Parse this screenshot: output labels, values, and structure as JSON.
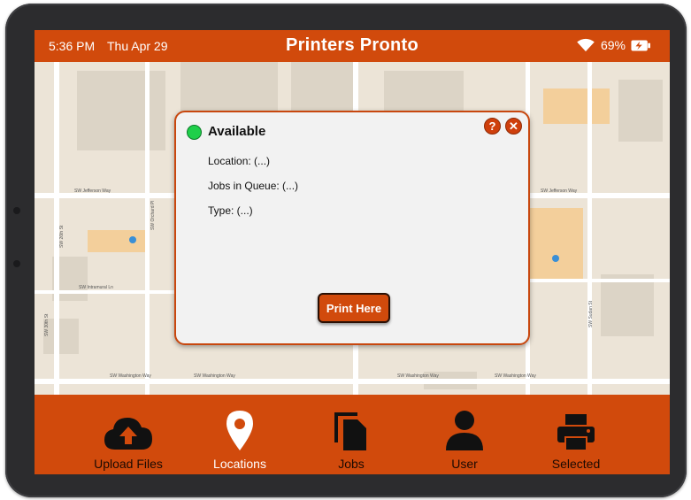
{
  "status_bar": {
    "time": "5:36 PM",
    "date": "Thu Apr 29",
    "battery": "69%",
    "wifi_icon": "wifi-icon",
    "battery_icon": "battery-charging-icon"
  },
  "app": {
    "title": "Printers Pronto",
    "accent_color": "#d14a0c"
  },
  "map": {
    "street_labels": [
      "SW Jefferson Way",
      "SW Jefferson Way",
      "SW Intramural Ln",
      "SW Washington Way",
      "SW Washington Way",
      "SW Washington Way",
      "SW Washington Way",
      "SW 26th St",
      "SW 30th St",
      "SW Orchard Pl",
      "SW Sudan St"
    ]
  },
  "dialog": {
    "status": "Available",
    "status_color": "#1fcf4a",
    "location": "Location: (...)",
    "jobs_in_queue": "Jobs in Queue: (...)",
    "type": "Type: (...)",
    "print_button": "Print Here",
    "help_icon": "help-icon",
    "close_icon": "close-icon"
  },
  "nav": {
    "items": [
      {
        "label": "Upload Files",
        "icon": "cloud-upload-icon"
      },
      {
        "label": "Locations",
        "icon": "location-pin-icon"
      },
      {
        "label": "Jobs",
        "icon": "documents-icon"
      },
      {
        "label": "User",
        "icon": "user-icon"
      },
      {
        "label": "Selected",
        "icon": "printer-icon"
      }
    ]
  }
}
